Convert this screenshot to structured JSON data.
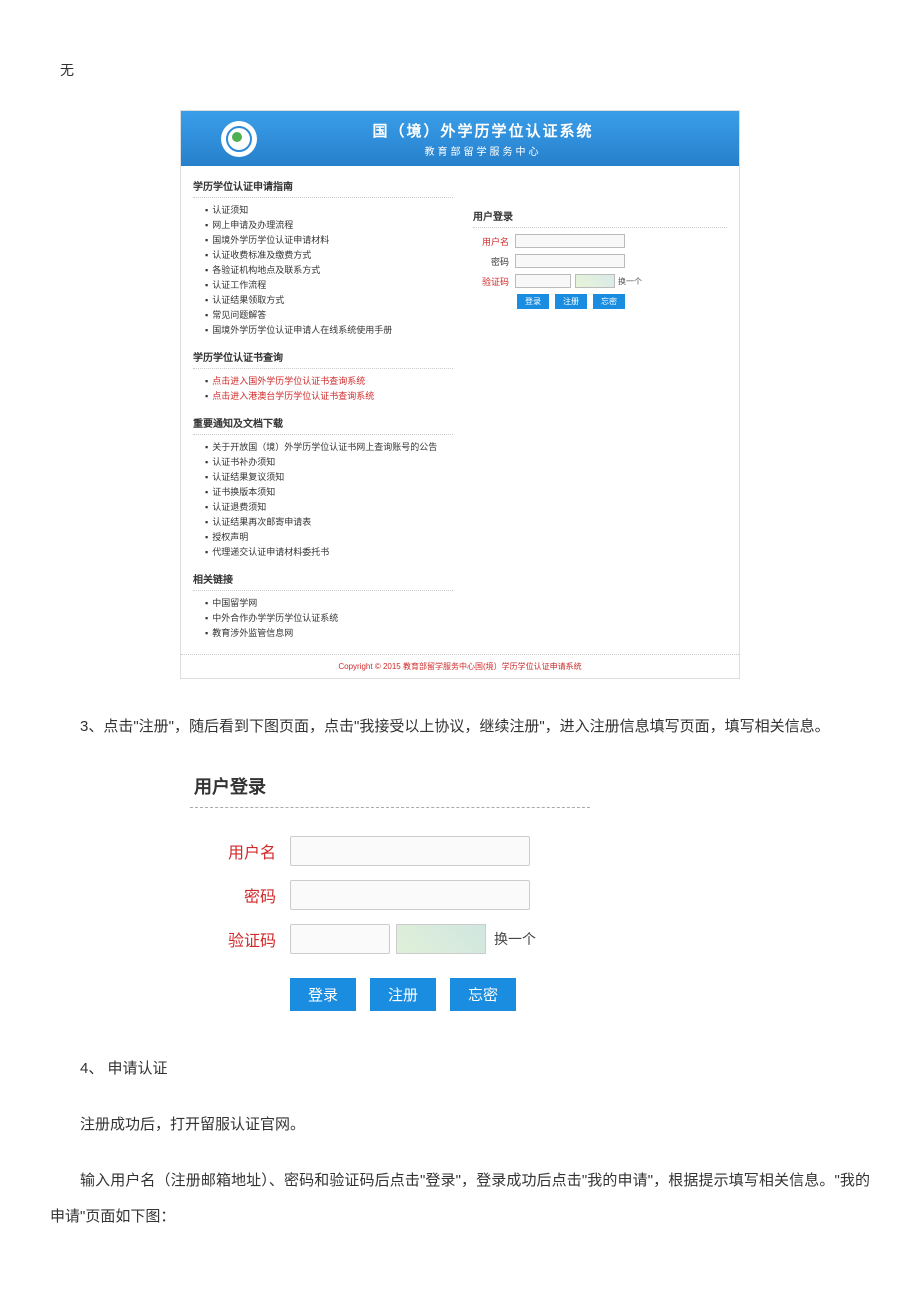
{
  "top_label": "无",
  "banner": {
    "title": "国（境）外学历学位认证系统",
    "subtitle": "教育部留学服务中心"
  },
  "sections": {
    "guide": {
      "title": "学历学位认证申请指南",
      "items": [
        "认证须知",
        "网上申请及办理流程",
        "国境外学历学位认证申请材料",
        "认证收费标准及缴费方式",
        "各验证机构地点及联系方式",
        "认证工作流程",
        "认证结果领取方式",
        "常见问题解答",
        "国境外学历学位认证申请人在线系统使用手册"
      ]
    },
    "query": {
      "title": "学历学位认证书查询",
      "items": [
        "点击进入国外学历学位认证书查询系统",
        "点击进入港澳台学历学位认证书查询系统"
      ]
    },
    "notice": {
      "title": "重要通知及文档下载",
      "items": [
        "关于开放国（境）外学历学位认证书网上查询账号的公告",
        "认证书补办须知",
        "认证结果复议须知",
        "证书换版本须知",
        "认证退费须知",
        "认证结果再次邮寄申请表",
        "授权声明",
        "代理递交认证申请材料委托书"
      ]
    },
    "links": {
      "title": "相关链接",
      "items": [
        "中国留学网",
        "中外合作办学学历学位认证系统",
        "教育涉外监管信息网"
      ]
    }
  },
  "login_small": {
    "title": "用户登录",
    "username": "用户名",
    "password": "密码",
    "captcha": "验证码",
    "refresh": "换一个",
    "btn_login": "登录",
    "btn_register": "注册",
    "btn_forgot": "忘密"
  },
  "copyright": "Copyright © 2015 教育部留学服务中心国(境）学历学位认证申请系统",
  "para1": "3、点击\"注册\"，随后看到下图页面，点击\"我接受以上协议，继续注册\"，进入注册信息填写页面，填写相关信息。",
  "login_big": {
    "title": "用户登录",
    "username": "用户名",
    "password": "密码",
    "captcha": "验证码",
    "captcha_text": "",
    "refresh": "换一个",
    "btn_login": "登录",
    "btn_register": "注册",
    "btn_forgot": "忘密"
  },
  "para2": "4、 申请认证",
  "para3": "注册成功后，打开留服认证官网。",
  "para4": "输入用户名（注册邮箱地址）、密码和验证码后点击\"登录\"，登录成功后点击\"我的申请\"，根据提示填写相关信息。\"我的申请\"页面如下图："
}
